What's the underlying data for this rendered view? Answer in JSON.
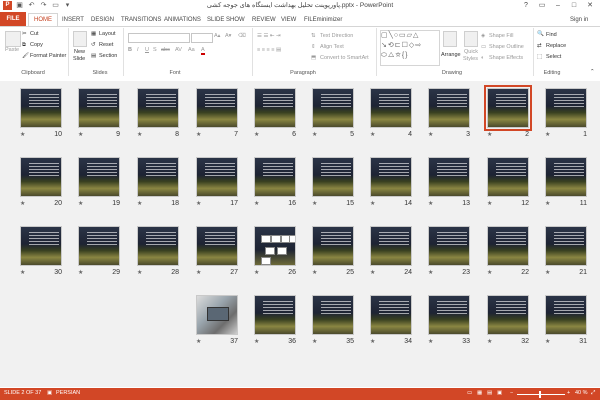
{
  "window": {
    "title": "پاورپوینت تحلیل بهداشت ایستگاه های جوجه کشی.pptx - PowerPoint",
    "signin": "Sign in",
    "controls": [
      "?",
      "▭",
      "–",
      "□",
      "✕"
    ]
  },
  "tabs": [
    "FILE",
    "HOME",
    "INSERT",
    "DESIGN",
    "TRANSITIONS",
    "ANIMATIONS",
    "SLIDE SHOW",
    "REVIEW",
    "VIEW",
    "FILEminimizer"
  ],
  "ribbon": {
    "clipboard": {
      "label": "Clipboard",
      "paste": "Paste",
      "cut": "Cut",
      "copy": "Copy",
      "format_painter": "Format Painter"
    },
    "slides": {
      "label": "Slides",
      "new_slide": "New",
      "new_slide2": "Slide",
      "layout": "Layout",
      "reset": "Reset",
      "section": "Section"
    },
    "font": {
      "label": "Font",
      "buttons": [
        "B",
        "I",
        "U",
        "S",
        "abc",
        "AV",
        "Aa",
        "A"
      ]
    },
    "paragraph": {
      "label": "Paragraph",
      "text_direction": "Text Direction",
      "align_text": "Align Text",
      "convert_smartart": "Convert to SmartArt"
    },
    "drawing": {
      "label": "Drawing",
      "arrange": "Arrange",
      "quick_styles": "Quick",
      "quick_styles2": "Styles",
      "shape_fill": "Shape Fill",
      "shape_outline": "Shape Outline",
      "shape_effects": "Shape Effects"
    },
    "editing": {
      "label": "Editing",
      "find": "Find",
      "replace": "Replace",
      "select": "Select"
    }
  },
  "slides": {
    "selected": 2,
    "rows": [
      [
        "10",
        "9",
        "8",
        "7",
        "6",
        "5",
        "4",
        "3",
        "2",
        "1"
      ],
      [
        "20",
        "19",
        "18",
        "17",
        "16",
        "15",
        "14",
        "13",
        "12",
        "11"
      ],
      [
        "30",
        "29",
        "28",
        "27",
        "26",
        "25",
        "24",
        "23",
        "22",
        "21"
      ],
      [
        "37",
        "36",
        "35",
        "34",
        "33",
        "32",
        "31"
      ]
    ],
    "star": "★"
  },
  "status": {
    "slide": "SLIDE 2 OF 37",
    "language": "PERSIAN",
    "zoom": "40 %"
  }
}
